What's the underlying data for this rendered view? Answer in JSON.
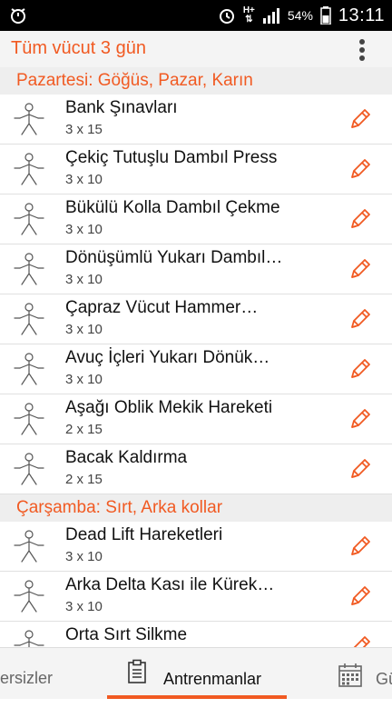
{
  "status_bar": {
    "battery": "54%",
    "time": "13:11",
    "network": "H+"
  },
  "app_bar": {
    "title": "Tüm vücut 3 gün",
    "menu_icon": "more-vert-icon"
  },
  "sections": [
    {
      "header": "Pazartesi: Göğüs, Pazar, Karın",
      "items": [
        {
          "name": "Bank Şınavları",
          "sets": "3 x 15"
        },
        {
          "name": "Çekiç Tutuşlu Dambıl Press",
          "sets": "3 x 10"
        },
        {
          "name": "Bükülü Kolla Dambıl Çekme",
          "sets": "3 x 10"
        },
        {
          "name": "Dönüşümlü Yukarı Dambıl…",
          "sets": "3 x 10"
        },
        {
          "name": "Çapraz Vücut Hammer…",
          "sets": "3 x 10"
        },
        {
          "name": "Avuç İçleri Yukarı Dönük…",
          "sets": "3 x 10"
        },
        {
          "name": "Aşağı Oblik Mekik Hareketi",
          "sets": "2 x 15"
        },
        {
          "name": "Bacak Kaldırma",
          "sets": "2 x 15"
        }
      ]
    },
    {
      "header": "Çarşamba: Sırt, Arka kollar",
      "items": [
        {
          "name": "Dead Lift Hareketleri",
          "sets": "3 x 10"
        },
        {
          "name": "Arka Delta Kası ile Kürek…",
          "sets": "3 x 10"
        },
        {
          "name": "Orta Sırt Silkme",
          "sets": ""
        }
      ]
    }
  ],
  "bottom_nav": {
    "left_tab": "ersizler",
    "center_tab": "Antrenmanlar",
    "right_tab": "Gü"
  },
  "colors": {
    "accent": "#f15a22"
  }
}
